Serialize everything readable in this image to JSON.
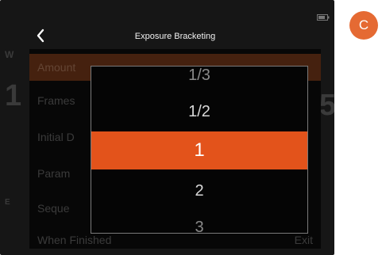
{
  "header": {
    "title": "Exposure Bracketing"
  },
  "menu": {
    "rows": [
      {
        "label": "Amount",
        "value": "",
        "selected": true
      },
      {
        "label": "Frames",
        "value": ""
      },
      {
        "label": "Initial D",
        "value": ""
      },
      {
        "label": "Param",
        "value": ""
      },
      {
        "label": "Seque",
        "value": ""
      },
      {
        "label": "When Finished",
        "value": "Exit"
      }
    ]
  },
  "picker": {
    "options": [
      "1/3",
      "1/2",
      "1",
      "2",
      "3"
    ],
    "selected": "1"
  },
  "badge": {
    "letter": "C"
  },
  "colors": {
    "accent": "#e3531b",
    "badge": "#e56a33"
  }
}
